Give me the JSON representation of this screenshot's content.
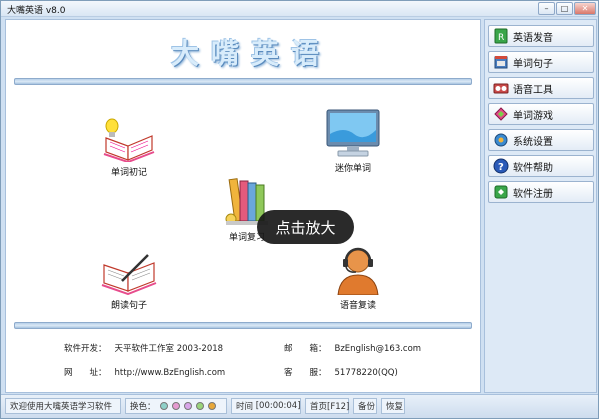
{
  "window": {
    "title": "大嘴英语 v8.0",
    "controls": {
      "minimize": "–",
      "maximize": "□",
      "close": "✕"
    }
  },
  "main": {
    "app_title": "大嘴英语",
    "features": [
      {
        "label": "单词初记",
        "icon": "book-lightbulb-icon"
      },
      {
        "label": "迷你单词",
        "icon": "monitor-icon"
      },
      {
        "label": "单词复习",
        "icon": "stacked-books-icon"
      },
      {
        "label": "朗读句子",
        "icon": "open-book-pen-icon"
      },
      {
        "label": "语音复读",
        "icon": "headset-person-icon"
      }
    ],
    "tooltip": "点击放大",
    "info": {
      "developer_label": "软件开发：",
      "developer_value": "天平软件工作室 2003-2018",
      "email_label": "邮　　箱：",
      "email_value": "BzEnglish@163.com",
      "website_label": "网　　址：",
      "website_value": "http://www.BzEnglish.com",
      "support_label": "客　　服：",
      "support_value": "51778220(QQ)"
    }
  },
  "sidebar": {
    "items": [
      {
        "label": "英语发音",
        "icon": "pronunciation-icon"
      },
      {
        "label": "单词句子",
        "icon": "dictionary-icon"
      },
      {
        "label": "语音工具",
        "icon": "audio-tool-icon"
      },
      {
        "label": "单词游戏",
        "icon": "game-icon"
      },
      {
        "label": "系统设置",
        "icon": "settings-icon"
      },
      {
        "label": "软件帮助",
        "icon": "help-icon"
      },
      {
        "label": "软件注册",
        "icon": "register-icon"
      }
    ]
  },
  "statusbar": {
    "welcome": "欢迎使用大嘴英语学习软件",
    "skin_label": "换色：",
    "skin_colors": [
      "#8fd0c8",
      "#e59bd0",
      "#d8a6e8",
      "#9ad47a",
      "#e8a83a"
    ],
    "time_label": "时间",
    "time_value": "[00:00:04]",
    "home_label": "首页[F12]",
    "backup_label": "备份",
    "restore_label": "恢复"
  }
}
